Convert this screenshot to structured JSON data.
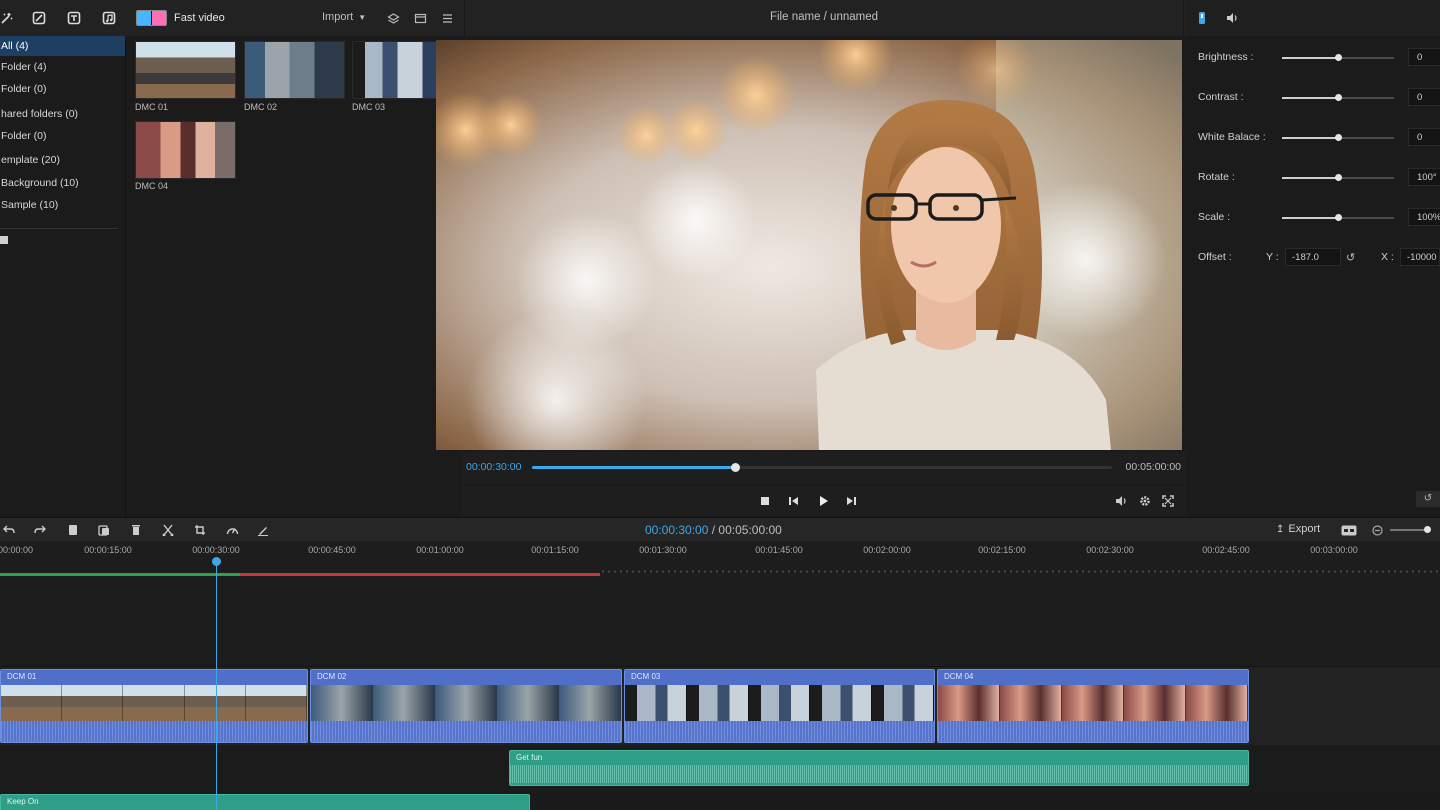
{
  "topbar": {
    "fast_video_label": "Fast video",
    "import_label": "Import",
    "file_name": "File name / unnamed",
    "icons": [
      "magic-icon",
      "crop-icon",
      "text-icon",
      "music-icon",
      "layers-icon",
      "screen-icon",
      "list-icon",
      "adjust-icon",
      "audio-icon"
    ]
  },
  "sidebar": {
    "items": [
      {
        "label": "All (4)",
        "active": true
      },
      {
        "label": "Folder (4)"
      },
      {
        "label": "Folder (0)"
      },
      {
        "label": "hared folders (0)"
      },
      {
        "label": "Folder (0)"
      },
      {
        "label": "emplate (20)"
      },
      {
        "label": "Background (10)"
      },
      {
        "label": "Sample (10)"
      }
    ]
  },
  "media": {
    "items": [
      {
        "label": "DMC 01"
      },
      {
        "label": "DMC 02"
      },
      {
        "label": "DMC 03"
      },
      {
        "label": "DMC 04"
      }
    ]
  },
  "preview": {
    "current_time": "00:00:30:00",
    "total_time": "00:05:00:00",
    "progress": 0.35
  },
  "properties": {
    "rows": [
      {
        "label": "Brightness :",
        "value": "0",
        "level": 0.5
      },
      {
        "label": "Contrast :",
        "value": "0",
        "level": 0.5
      },
      {
        "label": "White Balace :",
        "value": "0",
        "level": 0.5
      },
      {
        "label": "Rotate :",
        "value": "100°",
        "level": 0.5
      },
      {
        "label": "Scale :",
        "value": "100%",
        "level": 0.5
      }
    ],
    "offset": {
      "label": "Offset :",
      "y_label": "Y :",
      "y_value": "-187.0",
      "x_label": "X :",
      "x_value": "-10000"
    }
  },
  "timeline": {
    "current_time": "00:00:30:00",
    "separator": " / ",
    "total_time": "00:05:00:00",
    "export_label": "Export",
    "ruler_ticks": [
      "00:00:00",
      "00:00:15:00",
      "00:00:30:00",
      "00:00:45:00",
      "00:01:00:00",
      "00:01:15:00",
      "00:01:30:00",
      "00:01:45:00",
      "00:02:00:00",
      "00:02:15:00",
      "00:02:30:00",
      "00:02:45:00",
      "00:03:00:00"
    ],
    "video_clips": [
      {
        "label": "DCM 01"
      },
      {
        "label": "DCM 02"
      },
      {
        "label": "DCM 03"
      },
      {
        "label": "DCM 04"
      }
    ],
    "audio_clips": [
      {
        "label": "Get fun"
      },
      {
        "label": "Keep On"
      }
    ]
  },
  "colors": {
    "accent": "#3fa7e6",
    "video_clip": "#4f6fc8",
    "audio_clip": "#2f9e86",
    "range_in": "#2fa24a",
    "range_out": "#c7373a",
    "selection": "#1e3e63"
  }
}
